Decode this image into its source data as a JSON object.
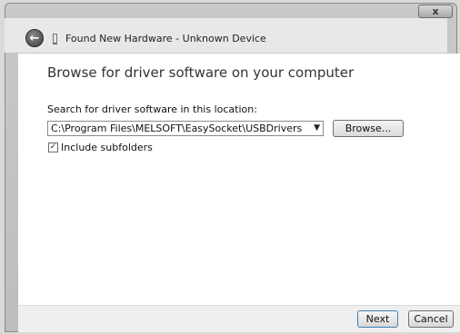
{
  "window": {
    "title": "Found New Hardware - Unknown Device",
    "close_label": "x"
  },
  "icons": {
    "back": "back-arrow-icon",
    "device": "device-icon"
  },
  "main": {
    "heading": "Browse for driver software on your computer",
    "search_label": "Search for driver software in this location:",
    "path_value": "C:\\Program Files\\MELSOFT\\EasySocket\\USBDrivers",
    "browse_label": "Browse...",
    "include_subfolders_label": "Include subfolders",
    "include_subfolders_checked": true
  },
  "footer": {
    "next_label": "Next",
    "cancel_label": "Cancel"
  }
}
